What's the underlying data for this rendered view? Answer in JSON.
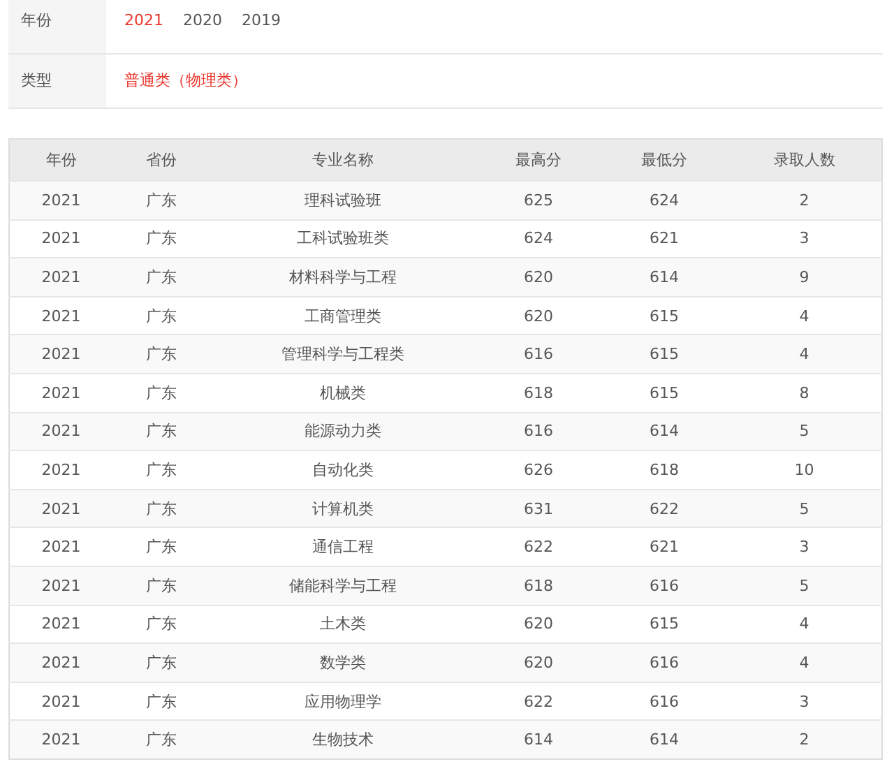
{
  "filters": [
    {
      "label": "年份",
      "options": [
        {
          "text": "2021",
          "selected": true
        },
        {
          "text": "2020",
          "selected": false
        },
        {
          "text": "2019",
          "selected": false
        }
      ]
    },
    {
      "label": "类型",
      "options": [
        {
          "text": "普通类（物理类）",
          "selected": true
        }
      ]
    }
  ],
  "table": {
    "columns": [
      "年份",
      "省份",
      "专业名称",
      "最高分",
      "最低分",
      "录取人数"
    ],
    "rows": [
      [
        "2021",
        "广东",
        "理科试验班",
        "625",
        "624",
        "2"
      ],
      [
        "2021",
        "广东",
        "工科试验班类",
        "624",
        "621",
        "3"
      ],
      [
        "2021",
        "广东",
        "材料科学与工程",
        "620",
        "614",
        "9"
      ],
      [
        "2021",
        "广东",
        "工商管理类",
        "620",
        "615",
        "4"
      ],
      [
        "2021",
        "广东",
        "管理科学与工程类",
        "616",
        "615",
        "4"
      ],
      [
        "2021",
        "广东",
        "机械类",
        "618",
        "615",
        "8"
      ],
      [
        "2021",
        "广东",
        "能源动力类",
        "616",
        "614",
        "5"
      ],
      [
        "2021",
        "广东",
        "自动化类",
        "626",
        "618",
        "10"
      ],
      [
        "2021",
        "广东",
        "计算机类",
        "631",
        "622",
        "5"
      ],
      [
        "2021",
        "广东",
        "通信工程",
        "622",
        "621",
        "3"
      ],
      [
        "2021",
        "广东",
        "储能科学与工程",
        "618",
        "616",
        "5"
      ],
      [
        "2021",
        "广东",
        "土木类",
        "620",
        "615",
        "4"
      ],
      [
        "2021",
        "广东",
        "数学类",
        "620",
        "616",
        "4"
      ],
      [
        "2021",
        "广东",
        "应用物理学",
        "622",
        "616",
        "3"
      ],
      [
        "2021",
        "广东",
        "生物技术",
        "614",
        "614",
        "2"
      ]
    ]
  }
}
